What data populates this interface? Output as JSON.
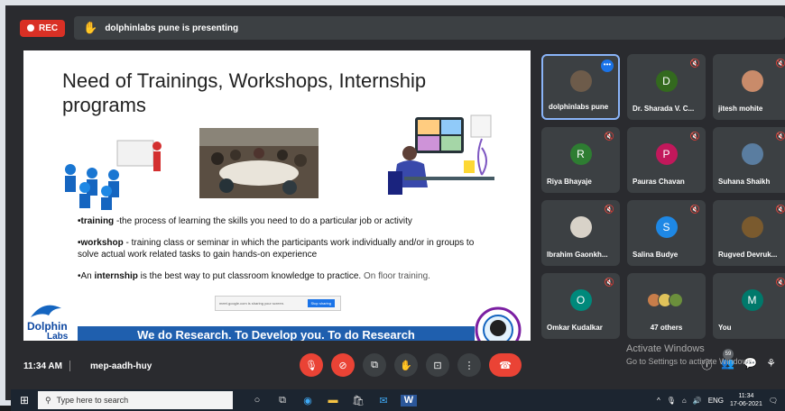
{
  "topbar": {
    "rec_label": "REC",
    "presenting_text": "dolphinlabs pune is presenting"
  },
  "slide": {
    "title": "Need of Trainings, Workshops, Internship programs",
    "bullets": [
      {
        "term": "•training ",
        "text": "-the process of learning the skills you need to do a particular job or activity"
      },
      {
        "term": "•workshop",
        "text": " - training class or seminar in which the participants work individually and/or in groups to solve actual work related tasks to gain hands-on experience"
      },
      {
        "pre": "•An ",
        "term": "internship",
        "text": " is the best way to put classroom knowledge to practice.",
        "extra": " On floor training."
      }
    ],
    "share_text": "meet.google.com is sharing your screen.",
    "stop_sharing": "Stop sharing",
    "logo_text_1": "Dolphin",
    "logo_text_2": "Labs",
    "footer_band": "We do Research. To Develop you. To do Research"
  },
  "participants": [
    {
      "name": "dolphinlabs pune",
      "type": "photo",
      "color": "#6d5b4a",
      "active": true
    },
    {
      "name": "Dr. Sharada V. C...",
      "type": "initial",
      "initial": "D",
      "color": "#33691e"
    },
    {
      "name": "jitesh mohite",
      "type": "photo",
      "color": "#c98b6a"
    },
    {
      "name": "Riya Bhayaje",
      "type": "initial",
      "initial": "R",
      "color": "#2e7d32"
    },
    {
      "name": "Pauras Chavan",
      "type": "initial",
      "initial": "P",
      "color": "#c2185b"
    },
    {
      "name": "Suhana Shaikh",
      "type": "photo",
      "color": "#5a7da0"
    },
    {
      "name": "Ibrahim Gaonkh...",
      "type": "photo",
      "color": "#d8d2c8"
    },
    {
      "name": "Salina Budye",
      "type": "initial",
      "initial": "S",
      "color": "#1e88e5"
    },
    {
      "name": "Rugved Devruk...",
      "type": "photo",
      "color": "#7a5a2e"
    },
    {
      "name": "Omkar Kudalkar",
      "type": "initial",
      "initial": "O",
      "color": "#00897b"
    },
    {
      "name": "47 others",
      "type": "others"
    },
    {
      "name": "You",
      "type": "initial",
      "initial": "M",
      "color": "#00796b"
    }
  ],
  "meetbar": {
    "time": "11:34 AM",
    "meeting_code": "mep-aadh-huy",
    "watermark_1": "Activate Windows",
    "watermark_2": "Go to Settings to activate Windows.",
    "people_badge": "59"
  },
  "taskbar": {
    "search_placeholder": "Type here to search",
    "lang": "ENG",
    "clock_time": "11:34",
    "clock_date": "17-06-2021"
  }
}
